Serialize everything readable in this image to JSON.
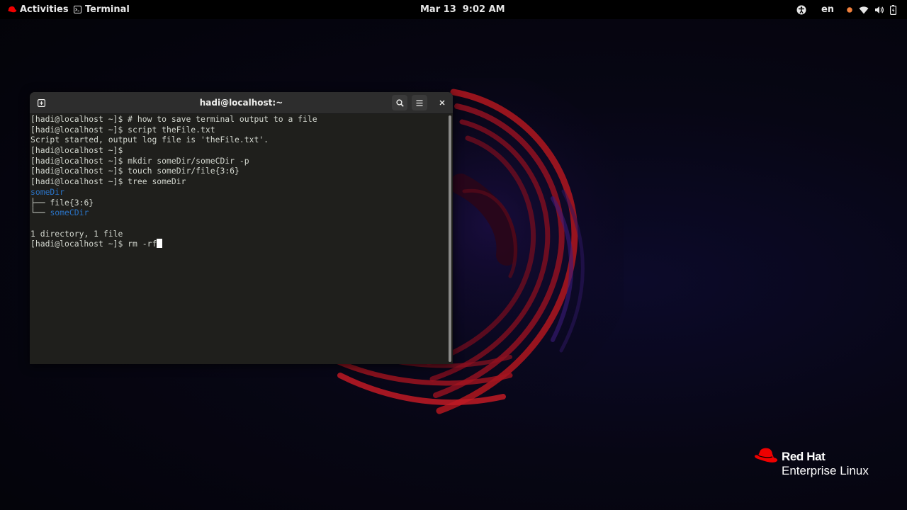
{
  "top_bar": {
    "activities_label": "Activities",
    "app_label": "Terminal",
    "date": "Mar 13",
    "time": "9:02 AM",
    "language": "en",
    "tray_icons": [
      "accessibility-icon",
      "language-indicator",
      "status-dot-icon",
      "wifi-icon",
      "volume-icon",
      "battery-icon"
    ],
    "status_dot_color": "#f0803c"
  },
  "terminal": {
    "title": "hadi@localhost:~",
    "lines": [
      {
        "text": "[hadi@localhost ~]$ # how to save terminal output to a file"
      },
      {
        "text": "[hadi@localhost ~]$ script theFile.txt"
      },
      {
        "text": "Script started, output log file is 'theFile.txt'."
      },
      {
        "text": "[hadi@localhost ~]$"
      },
      {
        "text": "[hadi@localhost ~]$ mkdir someDir/someCDir -p"
      },
      {
        "text": "[hadi@localhost ~]$ touch someDir/file{3:6}"
      },
      {
        "text": "[hadi@localhost ~]$ tree someDir"
      },
      {
        "text": "someDir"
      },
      {
        "prefix": "├── ",
        "text": "file{3:6}"
      },
      {
        "prefix": "└── ",
        "text": "someCDir"
      },
      {
        "text": ""
      },
      {
        "text": "1 directory, 1 file"
      },
      {
        "prompt": "[hadi@localhost ~]$ ",
        "input": "rm -rf"
      }
    ]
  },
  "branding": {
    "brand": "Red Hat",
    "product": "Enterprise Linux"
  },
  "colors": {
    "terminal_bg": "#1f1f1c",
    "terminal_fg": "#d3d7cf",
    "directory": "#2a73c5",
    "accent_red": "#ee0000"
  }
}
